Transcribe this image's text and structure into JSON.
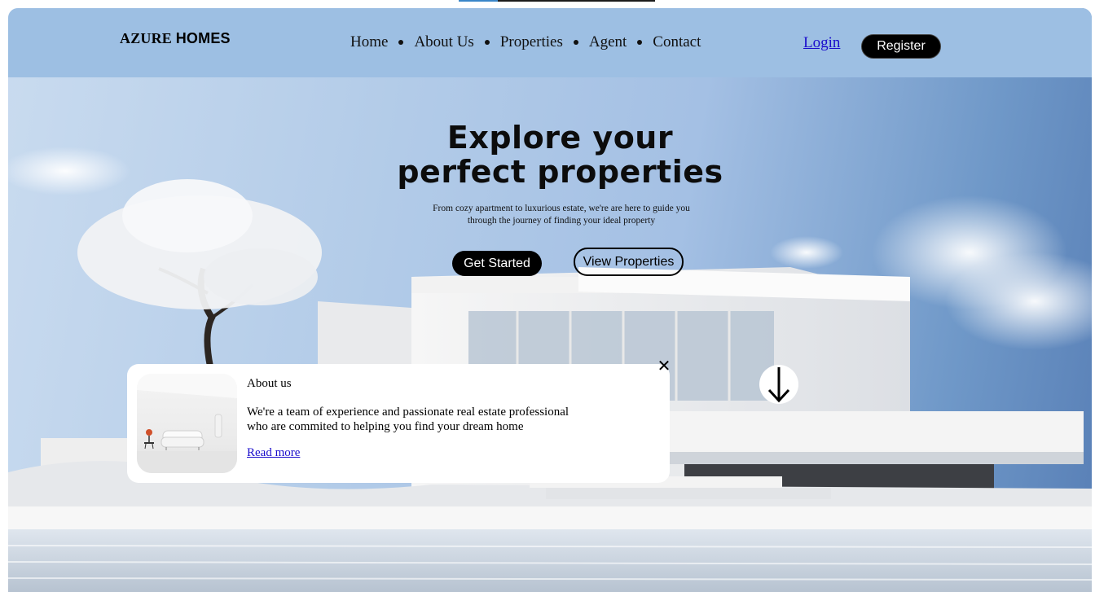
{
  "header": {
    "logo_main": "AZURE",
    "logo_bold": "HOMES",
    "nav": [
      "Home",
      "About Us",
      "Properties",
      "Agent",
      "Contact"
    ],
    "login": "Login",
    "register": "Register"
  },
  "hero": {
    "title_line1": "Explore your",
    "title_line2": "perfect properties",
    "subtitle_line1": "From cozy apartment to luxurious estate, we're are here to guide you",
    "subtitle_line2": "through the journey of finding your ideal property",
    "primary_button": "Get Started",
    "secondary_button": "View Properties"
  },
  "about_card": {
    "title": "About us",
    "text_line1": "We're a team of experience and passionate real estate professional",
    "text_line2": "who are commited to helping you find your dream home",
    "link": "Read more",
    "close_icon": "close-icon",
    "image_icon": "living-room-image"
  },
  "scroll": {
    "icon": "arrow-down-icon"
  },
  "colors": {
    "header_bg": "#9dbfe3",
    "button_bg": "#000000",
    "link": "#1a0dcc",
    "card_bg": "#ffffff"
  }
}
